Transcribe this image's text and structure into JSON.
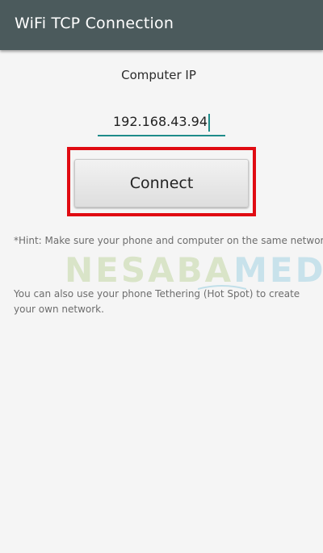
{
  "app_bar": {
    "title": "WiFi TCP Connection"
  },
  "form": {
    "ip_label": "Computer IP",
    "ip_value": "192.168.43.94",
    "connect_label": "Connect"
  },
  "hint_text": "*Hint: Make sure your phone and computer on the same network.",
  "tethering_text": "You can also use your phone Tethering (Hot Spot) to create your own network.",
  "watermark": {
    "part1": "NESABA",
    "part2": "MEDIA"
  },
  "colors": {
    "app_bar": "#4b5a5c",
    "accent": "#1e8c8a",
    "highlight": "#e00b12"
  }
}
